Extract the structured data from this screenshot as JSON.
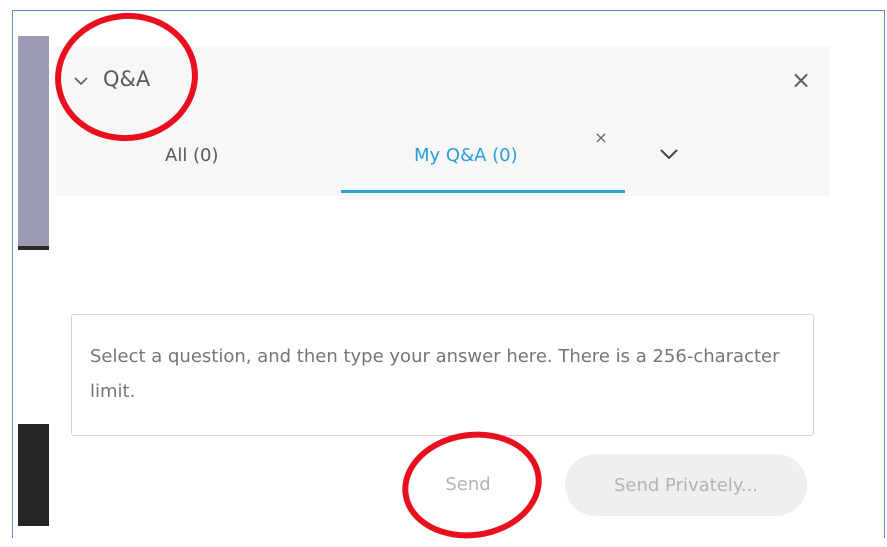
{
  "panel": {
    "title": "Q&A",
    "close_glyph": "×",
    "collapse_icon": "chevron-down-icon"
  },
  "tabs": [
    {
      "label": "All (0)",
      "selected": false
    },
    {
      "label": "My Q&A (0)",
      "selected": true
    }
  ],
  "tab_close_glyph": "×",
  "answer_input": {
    "placeholder": "Select a question, and then type your answer here. There is a 256-character limit.",
    "value": ""
  },
  "actions": {
    "send_label": "Send",
    "send_privately_label": "Send Privately..."
  },
  "colors": {
    "accent": "#29a3d1",
    "annotation": "#e8101c",
    "frame_border": "#5b8fd4",
    "header_bg": "#f7f7f7"
  }
}
